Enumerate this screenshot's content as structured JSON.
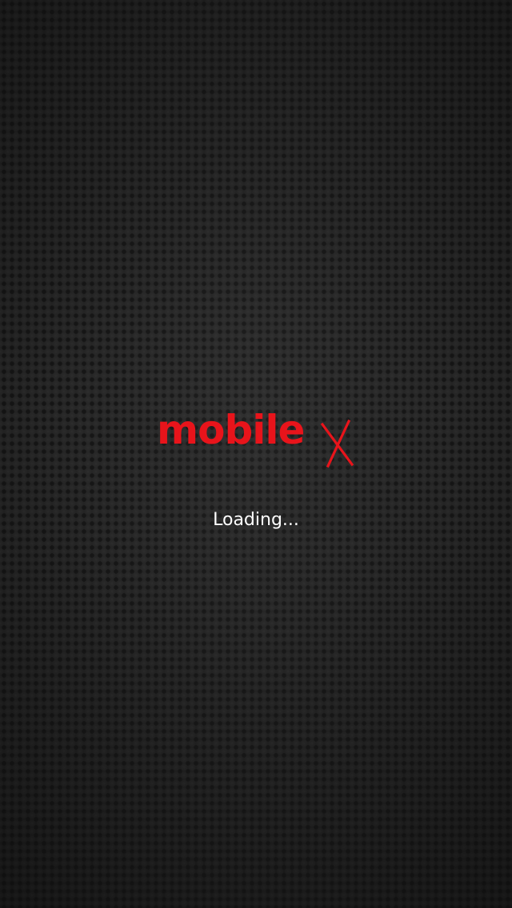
{
  "splash": {
    "logo": {
      "wordmark": "mobile",
      "mark_letter": "X",
      "color": "#e8141b"
    },
    "loading_text": "Loading..."
  },
  "theme": {
    "background": "#232323",
    "text_color": "#ffffff"
  }
}
